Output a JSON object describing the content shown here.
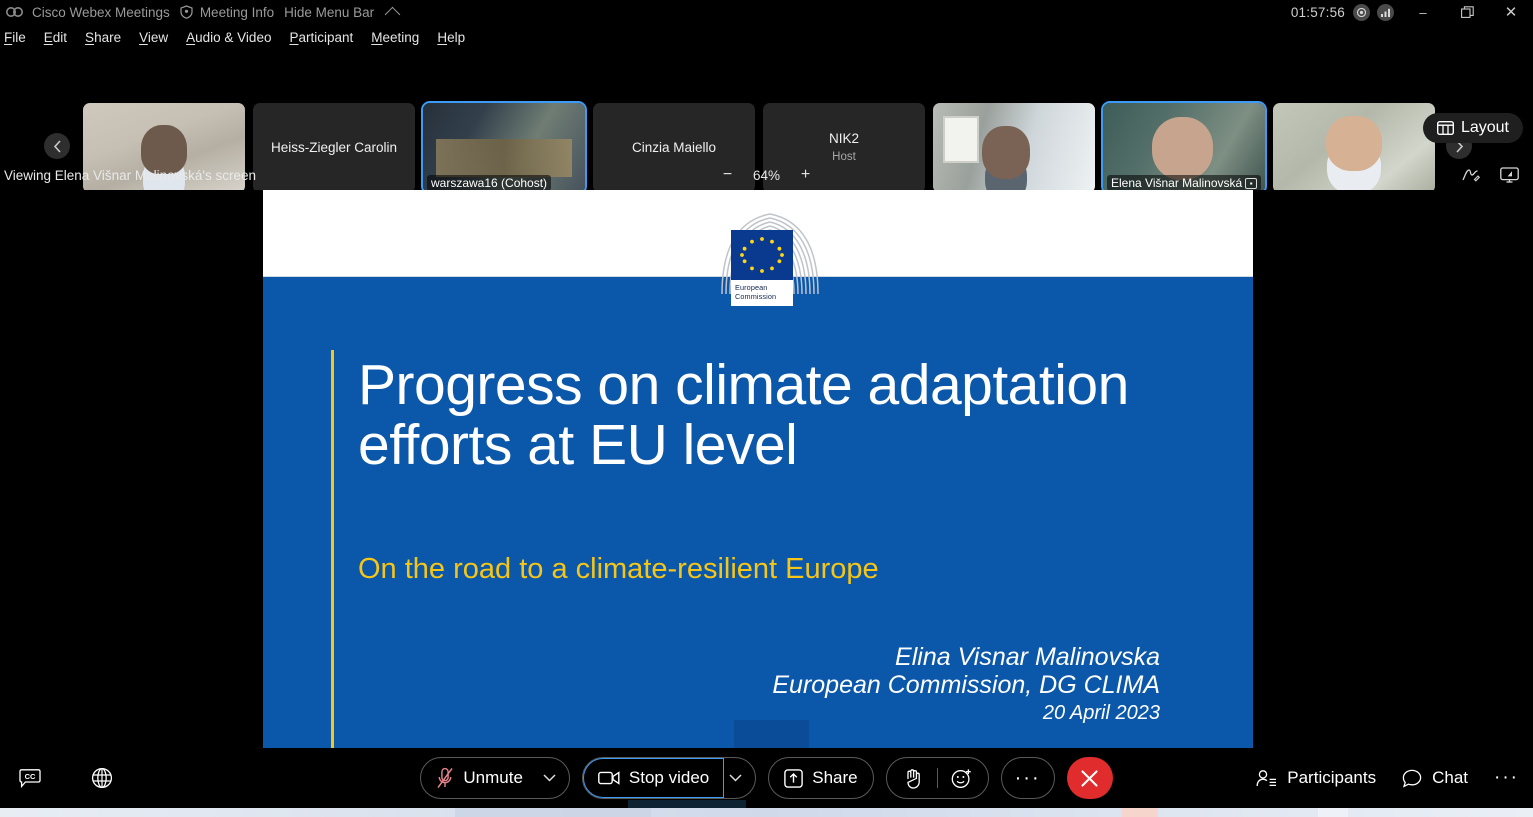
{
  "titlebar": {
    "app_logo_icon": "webex-logo-icon",
    "app_name": "Cisco Webex Meetings",
    "meeting_info_icon": "shield-icon",
    "meeting_info": "Meeting Info",
    "hide_menu_bar": "Hide Menu Bar",
    "chevron_icon": "chevron-up-icon",
    "clock": "01:57:56",
    "record_icon": "record-icon",
    "network_icon": "signal-bars-icon",
    "minimize": "–",
    "maximize_icon": "restore-window-icon",
    "close": "✕"
  },
  "menubar": {
    "items": [
      {
        "label": "File",
        "mnemonic": "F"
      },
      {
        "label": "Edit",
        "mnemonic": "E"
      },
      {
        "label": "Share",
        "mnemonic": "S"
      },
      {
        "label": "View",
        "mnemonic": "V"
      },
      {
        "label": "Audio & Video",
        "mnemonic": "A"
      },
      {
        "label": "Participant",
        "mnemonic": "P"
      },
      {
        "label": "Meeting",
        "mnemonic": "M"
      },
      {
        "label": "Help",
        "mnemonic": "H"
      }
    ]
  },
  "filmstrip": {
    "prev_icon": "chevron-left-icon",
    "next_icon": "chevron-right-icon",
    "layout_button": {
      "label": "Layout",
      "icon": "layout-grid-icon"
    },
    "thumbnails": [
      {
        "name": "",
        "role": "",
        "has_video": true,
        "selected": false,
        "badge": "",
        "video_class": "v1"
      },
      {
        "name": "Heiss-Ziegler Carolin",
        "role": "",
        "has_video": false,
        "selected": false,
        "badge": "",
        "video_class": ""
      },
      {
        "name": "warszawa16 (Cohost)",
        "role": "",
        "has_video": true,
        "selected": true,
        "badge": "warszawa16 (Cohost)",
        "video_class": "v2"
      },
      {
        "name": "Cinzia Maiello",
        "role": "",
        "has_video": false,
        "selected": false,
        "badge": "",
        "video_class": ""
      },
      {
        "name": "NIK2",
        "role": "Host",
        "has_video": false,
        "selected": false,
        "badge": "",
        "video_class": ""
      },
      {
        "name": "",
        "role": "",
        "has_video": true,
        "selected": false,
        "badge": "",
        "video_class": "v3"
      },
      {
        "name": "Elena Višnar Malinovská",
        "role": "",
        "has_video": true,
        "selected": true,
        "badge": "Elena Višnar Malinovská",
        "video_class": "v4"
      },
      {
        "name": "",
        "role": "",
        "has_video": true,
        "selected": false,
        "badge": "",
        "video_class": "v5"
      }
    ]
  },
  "viewbar": {
    "status": "Viewing Elena Višnar Malinovská's screen",
    "zoom_out": "−",
    "zoom_value": "64%",
    "zoom_in": "+",
    "annotate_icon": "annotate-pen-icon",
    "screen_icon": "monitor-screen-icon"
  },
  "slide": {
    "logo": {
      "institution_line1": "European",
      "institution_line2": "Commission",
      "icon": "eu-flag-icon"
    },
    "title": "Progress on climate adaptation efforts at EU level",
    "subtitle": "On the road to a climate-resilient Europe",
    "author": "Elina Visnar Malinovska",
    "organisation": "European Commission, DG CLIMA",
    "date": "20 April 2023",
    "colors": {
      "background_blue": "#0b57aa",
      "accent_yellow": "#f5c518",
      "text_white": "#ffffff"
    }
  },
  "controls": {
    "captions_icon": "closed-captions-icon",
    "interpretation_icon": "globe-icon",
    "mic": {
      "label": "Unmute",
      "icon": "mic-muted-icon",
      "caret_icon": "chevron-down-icon"
    },
    "video": {
      "label": "Stop video",
      "icon": "camera-icon",
      "caret_icon": "chevron-down-icon",
      "focused": true
    },
    "share": {
      "label": "Share",
      "icon": "share-screen-icon"
    },
    "reactions": {
      "hand_icon": "raise-hand-icon",
      "emoji_icon": "emoji-smile-icon"
    },
    "more_icon": "more-options-icon",
    "leave": {
      "icon": "close-x-icon",
      "color": "#e02c2c"
    },
    "participants": {
      "label": "Participants",
      "icon": "participants-icon"
    },
    "chat": {
      "label": "Chat",
      "icon": "chat-bubble-icon"
    },
    "more_right_icon": "more-options-icon"
  }
}
